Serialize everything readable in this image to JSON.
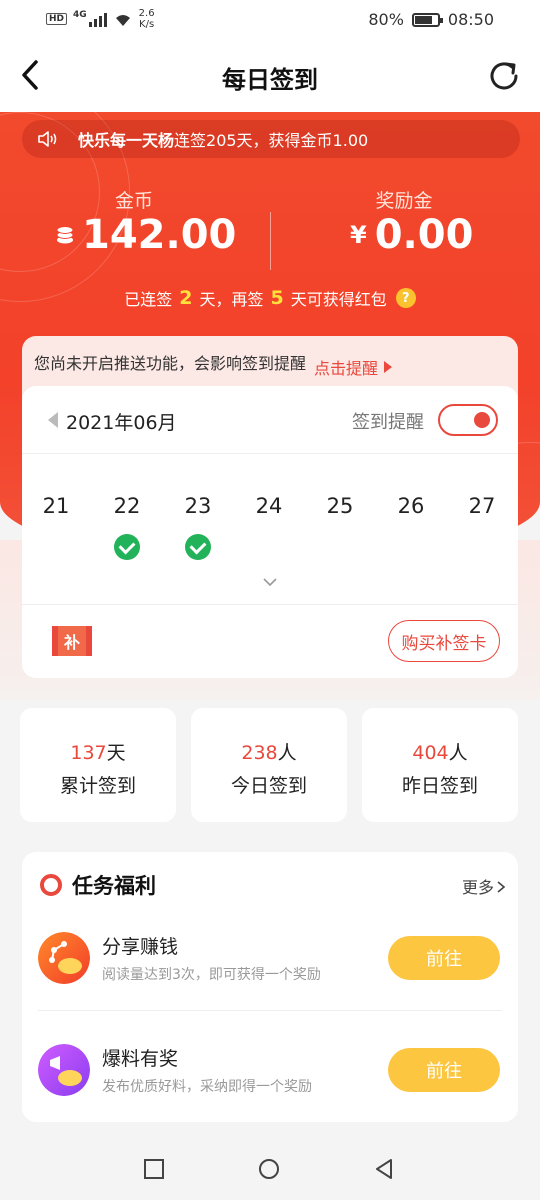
{
  "status_bar": {
    "hd": "HD",
    "network": "4G",
    "speed_value": "2.6",
    "speed_unit": "K/s",
    "battery": "80%",
    "battery_level": 0.8,
    "time": "08:50"
  },
  "nav": {
    "title": "每日签到",
    "icons": [
      "back-icon",
      "refresh-icon"
    ]
  },
  "notice": {
    "user": "快乐每一天杨",
    "message": "连签205天，获得金币1.00"
  },
  "coins": {
    "label": "金币",
    "value": "142.00"
  },
  "bonus": {
    "label": "奖励金",
    "currency": "¥",
    "value": "0.00"
  },
  "streak": {
    "prefix": "已连签",
    "days": "2",
    "mid": "天，再签",
    "remain": "5",
    "suffix": "天可获得红包",
    "help": "?"
  },
  "push_tip": {
    "text": "您尚未开启推送功能，会影响签到提醒",
    "link": "点击提醒"
  },
  "calendar": {
    "month": "2021年06月",
    "remind_label": "签到提醒",
    "remind_on": true,
    "days": [
      {
        "day": "21",
        "checked": false
      },
      {
        "day": "22",
        "checked": true
      },
      {
        "day": "23",
        "checked": true
      },
      {
        "day": "24",
        "checked": false
      },
      {
        "day": "25",
        "checked": false
      },
      {
        "day": "26",
        "checked": false
      },
      {
        "day": "27",
        "checked": false
      }
    ],
    "makeup_label": "补",
    "buy_button": "购买补签卡"
  },
  "stats": [
    {
      "num": "137",
      "unit": "天",
      "label": "累计签到"
    },
    {
      "num": "238",
      "unit": "人",
      "label": "今日签到"
    },
    {
      "num": "404",
      "unit": "人",
      "label": "昨日签到"
    }
  ],
  "tasks": {
    "title": "任务福利",
    "more": "更多",
    "items": [
      {
        "name": "分享赚钱",
        "desc": "阅读量达到3次，即可获得一个奖励",
        "button": "前往"
      },
      {
        "name": "爆料有奖",
        "desc": "发布优质好料，采纳即得一个奖励",
        "button": "前往"
      }
    ]
  },
  "colors": {
    "primary_red": "#f3412a",
    "accent_red": "#e9483c",
    "gold": "#fcc640",
    "check_green": "#22b35a"
  }
}
